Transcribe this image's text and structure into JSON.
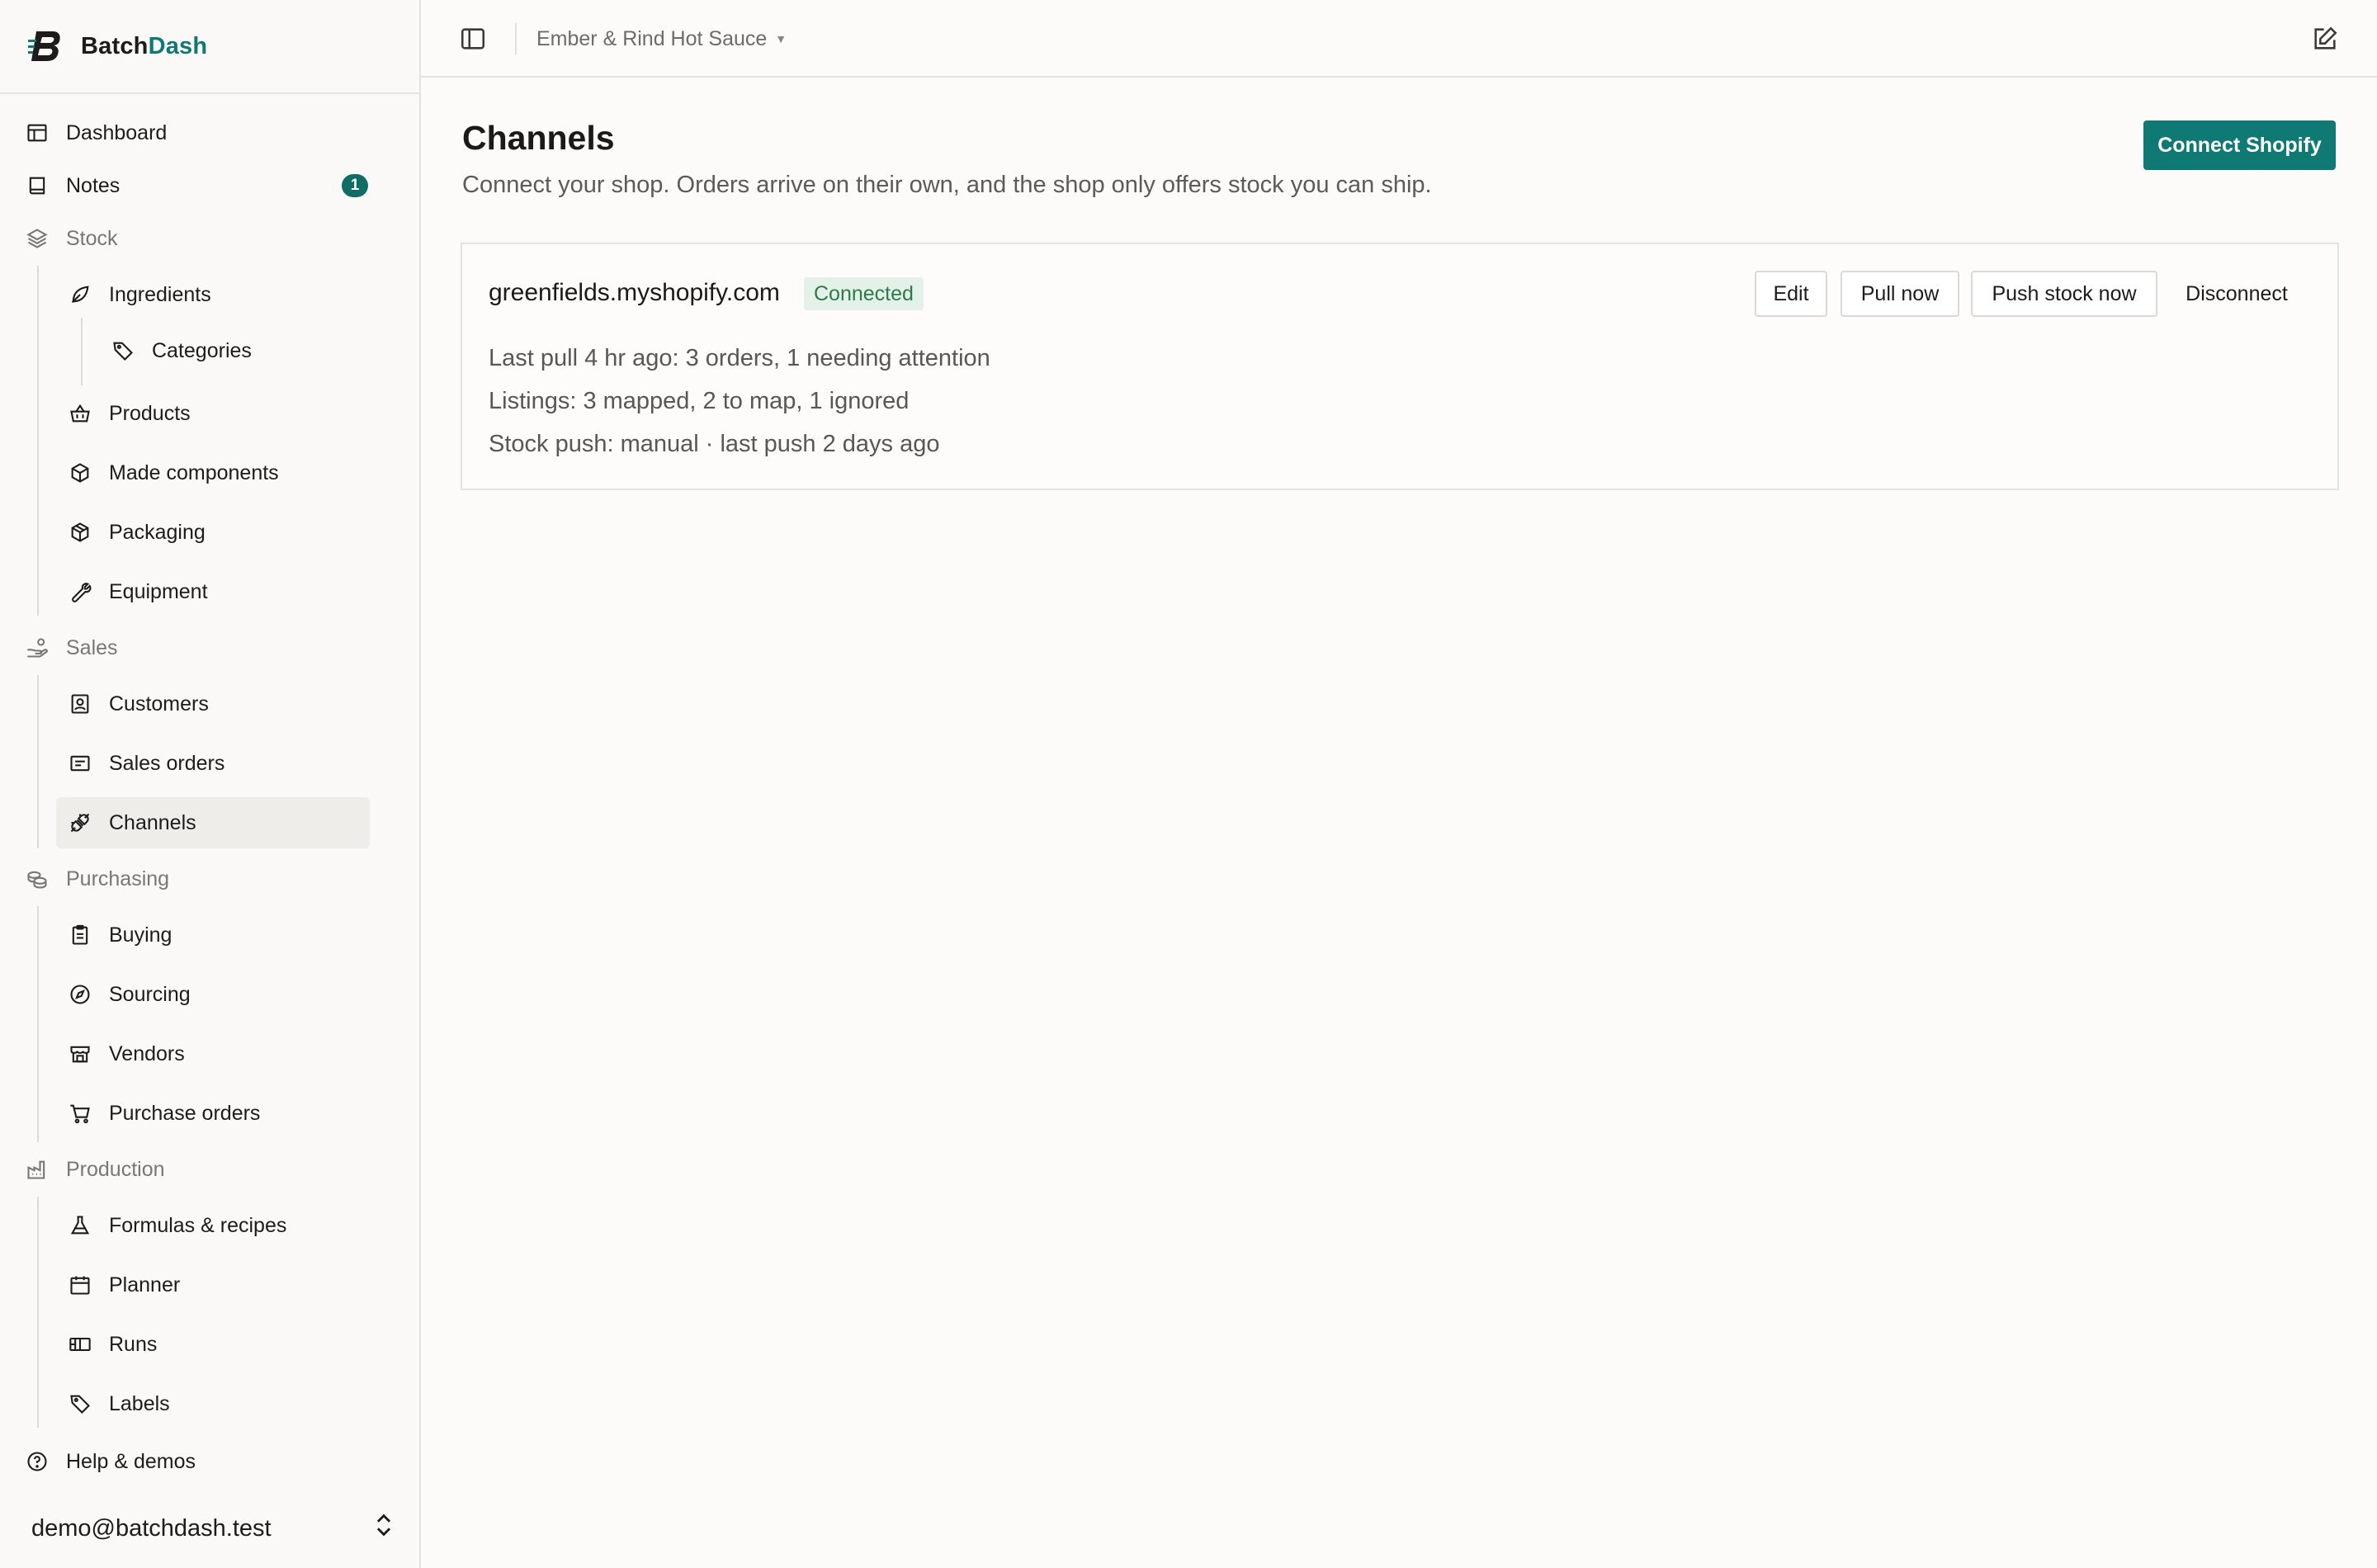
{
  "brand": {
    "name_part1": "Batch",
    "name_part2": "Dash",
    "accent_color": "#0e7a73"
  },
  "topbar": {
    "workspace": "Ember & Rind Hot Sauce"
  },
  "sidebar": {
    "items": [
      {
        "label": "Dashboard",
        "icon": "dashboard-icon"
      },
      {
        "label": "Notes",
        "icon": "notes-icon",
        "badge": "1"
      },
      {
        "label": "Stock",
        "icon": "layers-icon",
        "section": true
      },
      {
        "label": "Ingredients",
        "icon": "leaf-icon"
      },
      {
        "label": "Categories",
        "icon": "tag-icon"
      },
      {
        "label": "Products",
        "icon": "basket-icon"
      },
      {
        "label": "Made components",
        "icon": "box-icon"
      },
      {
        "label": "Packaging",
        "icon": "package-icon"
      },
      {
        "label": "Equipment",
        "icon": "wrench-icon"
      },
      {
        "label": "Sales",
        "icon": "hand-coins-icon",
        "section": true
      },
      {
        "label": "Customers",
        "icon": "contact-icon"
      },
      {
        "label": "Sales orders",
        "icon": "receipt-icon"
      },
      {
        "label": "Channels",
        "icon": "plug-icon",
        "active": true
      },
      {
        "label": "Purchasing",
        "icon": "coins-icon",
        "section": true
      },
      {
        "label": "Buying",
        "icon": "clipboard-icon"
      },
      {
        "label": "Sourcing",
        "icon": "compass-icon"
      },
      {
        "label": "Vendors",
        "icon": "store-icon"
      },
      {
        "label": "Purchase orders",
        "icon": "cart-icon"
      },
      {
        "label": "Production",
        "icon": "factory-icon",
        "section": true
      },
      {
        "label": "Formulas & recipes",
        "icon": "flask-icon"
      },
      {
        "label": "Planner",
        "icon": "calendar-icon"
      },
      {
        "label": "Runs",
        "icon": "runs-icon"
      },
      {
        "label": "Labels",
        "icon": "label-tag-icon"
      },
      {
        "label": "Help & demos",
        "icon": "help-icon"
      }
    ],
    "user_email": "demo@batchdash.test"
  },
  "main": {
    "title": "Channels",
    "subtitle": "Connect your shop. Orders arrive on their own, and the shop only offers stock you can ship.",
    "connect_button": "Connect Shopify",
    "channel": {
      "domain": "greenfields.myshopify.com",
      "status": "Connected",
      "lines": [
        "Last pull 4 hr ago: 3 orders, 1 needing attention",
        "Listings: 3 mapped, 2 to map, 1 ignored",
        "Stock push: manual · last push 2 days ago"
      ],
      "actions": {
        "edit": "Edit",
        "pull": "Pull now",
        "push": "Push stock now",
        "disconnect": "Disconnect"
      }
    }
  }
}
